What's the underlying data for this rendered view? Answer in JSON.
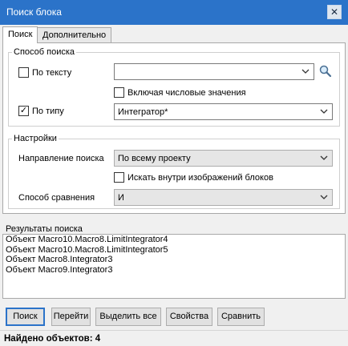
{
  "window": {
    "title": "Поиск блока",
    "close_glyph": "✕"
  },
  "tabs": [
    {
      "label": "Поиск",
      "active": true
    },
    {
      "label": "Дополнительно",
      "active": false
    }
  ],
  "search_method": {
    "group_title": "Способ поиска",
    "by_text": {
      "label": "По тексту",
      "checked": false,
      "value": ""
    },
    "include_numeric": {
      "label": "Включая числовые значения",
      "checked": false
    },
    "by_type": {
      "label": "По типу",
      "checked": true,
      "value": "Интегратор*"
    }
  },
  "settings": {
    "group_title": "Настройки",
    "direction": {
      "label": "Направление поиска",
      "value": "По всему проекту"
    },
    "search_in_images": {
      "label": "Искать внутри изображений блоков",
      "checked": false
    },
    "comparison": {
      "label": "Способ сравнения",
      "value": "И"
    }
  },
  "results": {
    "label": "Результаты поиска",
    "items": [
      "Объект Macro10.Macro8.LimitIntegrator4",
      "Объект Macro10.Macro8.LimitIntegrator5",
      "Объект Macro8.Integrator3",
      "Объект Macro9.Integrator3"
    ]
  },
  "buttons": {
    "search": "Поиск",
    "goto": "Перейти",
    "select_all": "Выделить все",
    "properties": "Свойства",
    "compare": "Сравнить"
  },
  "status": {
    "text": "Найдено объектов: 4"
  },
  "colors": {
    "titlebar": "#2b73c9",
    "default_button_border": "#2b73c9"
  },
  "icons": {
    "search": "magnifier-icon",
    "dropdown": "chevron-down-icon",
    "close": "close-icon"
  }
}
